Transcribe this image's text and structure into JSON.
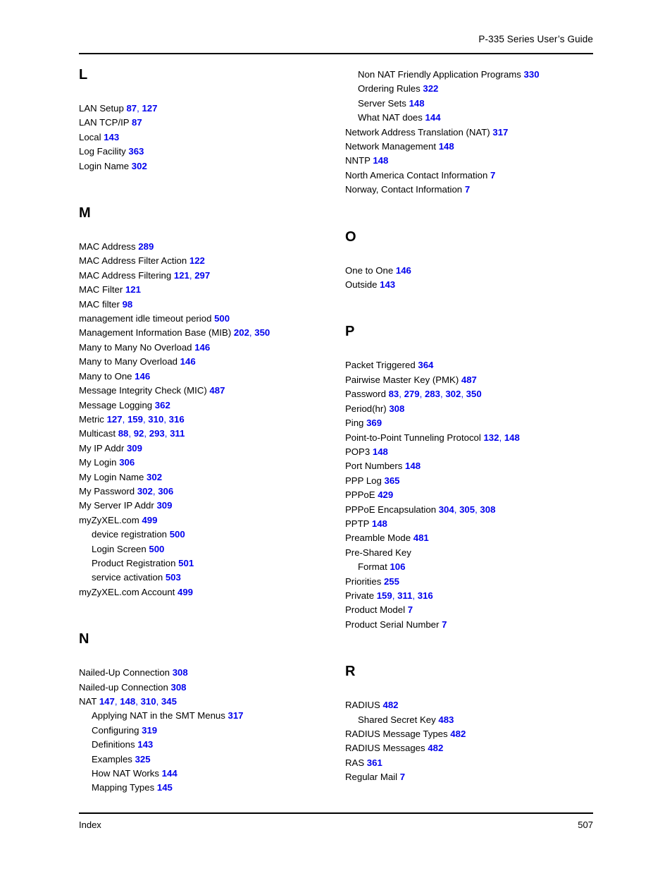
{
  "header": {
    "title": "P-335 Series User’s Guide"
  },
  "footer": {
    "section_label": "Index",
    "page_number": "507"
  },
  "colors": {
    "page_number_link": "#0000EE",
    "text": "#000000",
    "rule": "#000000",
    "background": "#FFFFFF"
  },
  "columns": [
    {
      "id": "left",
      "blocks": [
        {
          "letter": "L",
          "entries": [
            {
              "label": "LAN Setup",
              "pages": [
                "87",
                "127"
              ],
              "level": 0
            },
            {
              "label": "LAN TCP/IP",
              "pages": [
                "87"
              ],
              "level": 0
            },
            {
              "label": "Local",
              "pages": [
                "143"
              ],
              "level": 0
            },
            {
              "label": "Log Facility",
              "pages": [
                "363"
              ],
              "level": 0
            },
            {
              "label": "Login Name",
              "pages": [
                "302"
              ],
              "level": 0
            }
          ]
        },
        {
          "letter": "M",
          "entries": [
            {
              "label": "MAC Address",
              "pages": [
                "289"
              ],
              "level": 0
            },
            {
              "label": "MAC Address Filter Action",
              "pages": [
                "122"
              ],
              "level": 0
            },
            {
              "label": "MAC Address Filtering",
              "pages": [
                "121",
                "297"
              ],
              "level": 0
            },
            {
              "label": "MAC Filter",
              "pages": [
                "121"
              ],
              "level": 0
            },
            {
              "label": "MAC filter",
              "pages": [
                "98"
              ],
              "level": 0
            },
            {
              "label": "management idle timeout period",
              "pages": [
                "500"
              ],
              "level": 0
            },
            {
              "label": "Management Information Base (MIB)",
              "pages": [
                "202",
                "350"
              ],
              "level": 0
            },
            {
              "label": "Many to Many No Overload",
              "pages": [
                "146"
              ],
              "level": 0
            },
            {
              "label": "Many to Many Overload",
              "pages": [
                "146"
              ],
              "level": 0
            },
            {
              "label": "Many to One",
              "pages": [
                "146"
              ],
              "level": 0
            },
            {
              "label": "Message Integrity Check (MIC)",
              "pages": [
                "487"
              ],
              "level": 0
            },
            {
              "label": "Message Logging",
              "pages": [
                "362"
              ],
              "level": 0
            },
            {
              "label": "Metric",
              "pages": [
                "127",
                "159",
                "310",
                "316"
              ],
              "level": 0
            },
            {
              "label": "Multicast",
              "pages": [
                "88",
                "92",
                "293",
                "311"
              ],
              "level": 0
            },
            {
              "label": "My IP Addr",
              "pages": [
                "309"
              ],
              "level": 0
            },
            {
              "label": "My Login",
              "pages": [
                "306"
              ],
              "level": 0
            },
            {
              "label": "My Login Name",
              "pages": [
                "302"
              ],
              "level": 0
            },
            {
              "label": "My Password",
              "pages": [
                "302",
                "306"
              ],
              "level": 0
            },
            {
              "label": "My Server IP Addr",
              "pages": [
                "309"
              ],
              "level": 0
            },
            {
              "label": "myZyXEL.com",
              "pages": [
                "499"
              ],
              "level": 0
            },
            {
              "label": "device registration",
              "pages": [
                "500"
              ],
              "level": 1
            },
            {
              "label": "Login Screen",
              "pages": [
                "500"
              ],
              "level": 1
            },
            {
              "label": "Product Registration",
              "pages": [
                "501"
              ],
              "level": 1
            },
            {
              "label": "service activation",
              "pages": [
                "503"
              ],
              "level": 1
            },
            {
              "label": "myZyXEL.com Account",
              "pages": [
                "499"
              ],
              "level": 0
            }
          ]
        },
        {
          "letter": "N",
          "entries": [
            {
              "label": "Nailed-Up Connection",
              "pages": [
                "308"
              ],
              "level": 0
            },
            {
              "label": "Nailed-up Connection",
              "pages": [
                "308"
              ],
              "level": 0
            },
            {
              "label": "NAT",
              "pages": [
                "147",
                "148",
                "310",
                "345"
              ],
              "level": 0
            },
            {
              "label": "Applying NAT in the SMT Menus",
              "pages": [
                "317"
              ],
              "level": 1
            },
            {
              "label": "Configuring",
              "pages": [
                "319"
              ],
              "level": 1
            },
            {
              "label": "Definitions",
              "pages": [
                "143"
              ],
              "level": 1
            },
            {
              "label": "Examples",
              "pages": [
                "325"
              ],
              "level": 1
            },
            {
              "label": "How NAT Works",
              "pages": [
                "144"
              ],
              "level": 1
            },
            {
              "label": "Mapping Types",
              "pages": [
                "145"
              ],
              "level": 1
            }
          ]
        }
      ]
    },
    {
      "id": "right",
      "blocks": [
        {
          "letter": "",
          "entries": [
            {
              "label": "Non NAT Friendly Application Programs",
              "pages": [
                "330"
              ],
              "level": 1
            },
            {
              "label": "Ordering Rules",
              "pages": [
                "322"
              ],
              "level": 1
            },
            {
              "label": "Server Sets",
              "pages": [
                "148"
              ],
              "level": 1
            },
            {
              "label": "What NAT does",
              "pages": [
                "144"
              ],
              "level": 1
            },
            {
              "label": "Network Address Translation (NAT)",
              "pages": [
                "317"
              ],
              "level": 0
            },
            {
              "label": "Network Management",
              "pages": [
                "148"
              ],
              "level": 0
            },
            {
              "label": "NNTP",
              "pages": [
                "148"
              ],
              "level": 0
            },
            {
              "label": "North America Contact Information",
              "pages": [
                "7"
              ],
              "level": 0
            },
            {
              "label": "Norway, Contact Information",
              "pages": [
                "7"
              ],
              "level": 0
            }
          ]
        },
        {
          "letter": "O",
          "entries": [
            {
              "label": "One to One",
              "pages": [
                "146"
              ],
              "level": 0
            },
            {
              "label": "Outside",
              "pages": [
                "143"
              ],
              "level": 0
            }
          ]
        },
        {
          "letter": "P",
          "entries": [
            {
              "label": "Packet Triggered",
              "pages": [
                "364"
              ],
              "level": 0
            },
            {
              "label": "Pairwise Master Key (PMK)",
              "pages": [
                "487"
              ],
              "level": 0
            },
            {
              "label": "Password",
              "pages": [
                "83",
                "279",
                "283",
                "302",
                "350"
              ],
              "level": 0
            },
            {
              "label": "Period(hr)",
              "pages": [
                "308"
              ],
              "level": 0
            },
            {
              "label": "Ping",
              "pages": [
                "369"
              ],
              "level": 0
            },
            {
              "label": "Point-to-Point Tunneling Protocol",
              "pages": [
                "132",
                "148"
              ],
              "level": 0
            },
            {
              "label": "POP3",
              "pages": [
                "148"
              ],
              "level": 0
            },
            {
              "label": "Port Numbers",
              "pages": [
                "148"
              ],
              "level": 0
            },
            {
              "label": "PPP Log",
              "pages": [
                "365"
              ],
              "level": 0
            },
            {
              "label": "PPPoE",
              "pages": [
                "429"
              ],
              "level": 0
            },
            {
              "label": "PPPoE Encapsulation",
              "pages": [
                "304",
                "305",
                "308"
              ],
              "level": 0
            },
            {
              "label": "PPTP",
              "pages": [
                "148"
              ],
              "level": 0
            },
            {
              "label": "Preamble Mode",
              "pages": [
                "481"
              ],
              "level": 0
            },
            {
              "label": "Pre-Shared Key",
              "pages": [],
              "level": 0
            },
            {
              "label": "Format",
              "pages": [
                "106"
              ],
              "level": 1
            },
            {
              "label": "Priorities",
              "pages": [
                "255"
              ],
              "level": 0
            },
            {
              "label": "Private",
              "pages": [
                "159",
                "311",
                "316"
              ],
              "level": 0
            },
            {
              "label": "Product Model",
              "pages": [
                "7"
              ],
              "level": 0
            },
            {
              "label": "Product Serial Number",
              "pages": [
                "7"
              ],
              "level": 0
            }
          ]
        },
        {
          "letter": "R",
          "entries": [
            {
              "label": "RADIUS",
              "pages": [
                "482"
              ],
              "level": 0
            },
            {
              "label": "Shared Secret Key",
              "pages": [
                "483"
              ],
              "level": 1
            },
            {
              "label": "RADIUS Message Types",
              "pages": [
                "482"
              ],
              "level": 0
            },
            {
              "label": "RADIUS Messages",
              "pages": [
                "482"
              ],
              "level": 0
            },
            {
              "label": "RAS",
              "pages": [
                "361"
              ],
              "level": 0
            },
            {
              "label": "Regular Mail",
              "pages": [
                "7"
              ],
              "level": 0
            }
          ]
        }
      ]
    }
  ]
}
